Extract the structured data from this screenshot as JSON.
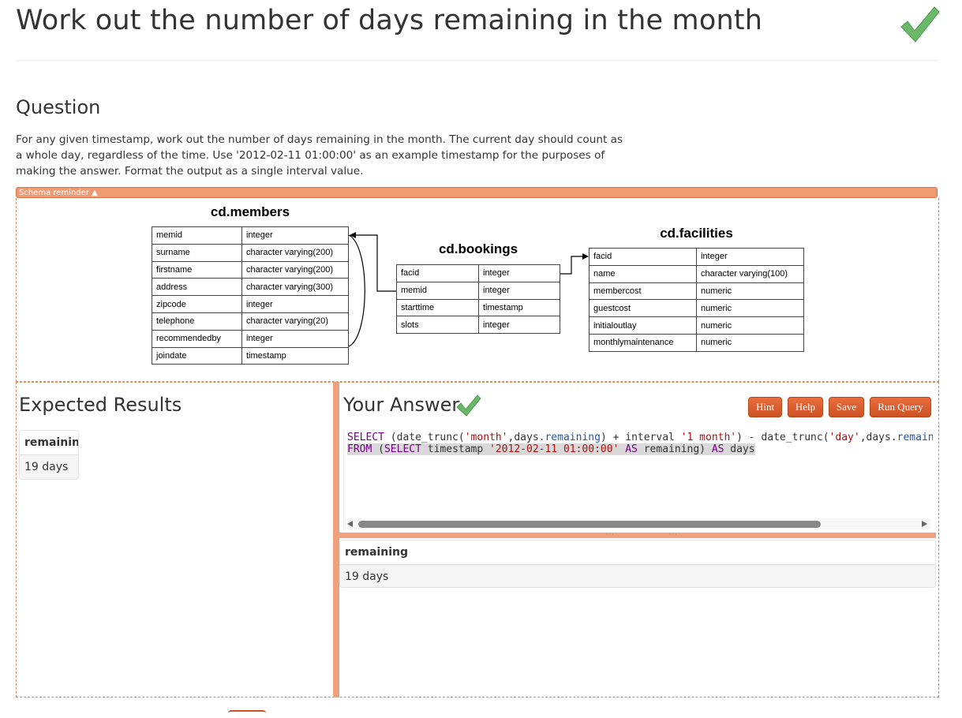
{
  "page": {
    "title": "Work out the number of days remaining in the month"
  },
  "question": {
    "heading": "Question",
    "text": "For any given timestamp, work out the number of days remaining in the month. The current day should count as a whole day, regardless of the time. Use '2012-02-11 01:00:00' as an example timestamp for the purposes of making the answer. Format the output as a single interval value."
  },
  "schema": {
    "toggle_label": "Schema reminder ▲",
    "tables": {
      "members": {
        "name": "cd.members",
        "rows": [
          [
            "memid",
            "integer"
          ],
          [
            "surname",
            "character varying(200)"
          ],
          [
            "firstname",
            "character varying(200)"
          ],
          [
            "address",
            "character varying(300)"
          ],
          [
            "zipcode",
            "integer"
          ],
          [
            "telephone",
            "character varying(20)"
          ],
          [
            "recommendedby",
            "integer"
          ],
          [
            "joindate",
            "timestamp"
          ]
        ]
      },
      "bookings": {
        "name": "cd.bookings",
        "rows": [
          [
            "facid",
            "integer"
          ],
          [
            "memid",
            "integer"
          ],
          [
            "starttime",
            "timestamp"
          ],
          [
            "slots",
            "integer"
          ]
        ]
      },
      "facilities": {
        "name": "cd.facilities",
        "rows": [
          [
            "facid",
            "integer"
          ],
          [
            "name",
            "character varying(100)"
          ],
          [
            "membercost",
            "numeric"
          ],
          [
            "guestcost",
            "numeric"
          ],
          [
            "initialoutlay",
            "numeric"
          ],
          [
            "monthlymaintenance",
            "numeric"
          ]
        ]
      }
    }
  },
  "expected": {
    "heading": "Expected Results",
    "column": "remaining",
    "value": "19 days"
  },
  "answer": {
    "heading": "Your Answer",
    "buttons": {
      "hint": "Hint",
      "help": "Help",
      "save": "Save",
      "run": "Run Query"
    },
    "code": {
      "line1": {
        "kw_select": "SELECT",
        "p1": " (date_trunc(",
        "s1": "'month'",
        "p2": ",days.",
        "prop1": "remaining",
        "p3": ") + interval ",
        "s2": "'1 month'",
        "p4": ") - date_trunc(",
        "s3": "'day'",
        "p5": ",days.",
        "prop2": "remaining",
        "p6": ")"
      },
      "line2": {
        "kw_from": "FROM",
        "p1": " (",
        "kw_select": "SELECT",
        "p2": " timestamp ",
        "s1": "'2012-02-11 01:00:00'",
        "p3": " ",
        "kw_as1": "AS",
        "p4": " remaining) ",
        "kw_as2": "AS",
        "p5": " days"
      }
    },
    "output_column": "remaining",
    "output_value": "19 days"
  }
}
